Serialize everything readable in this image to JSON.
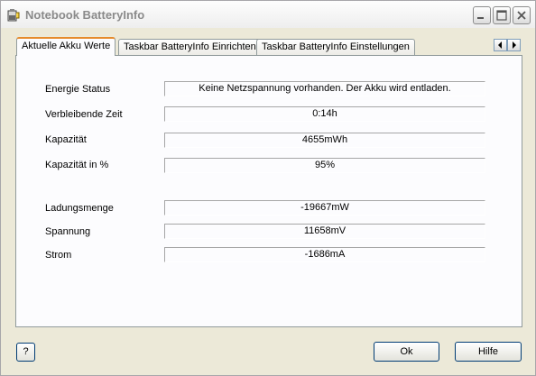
{
  "window": {
    "title": "Notebook BatteryInfo"
  },
  "tabs": [
    {
      "label": "Aktuelle Akku Werte"
    },
    {
      "label": "Taskbar BatteryInfo Einrichten"
    },
    {
      "label": "Taskbar BatteryInfo Einstellungen"
    }
  ],
  "fields": [
    {
      "label": "Energie Status",
      "value": "Keine Netzspannung vorhanden. Der Akku wird entladen."
    },
    {
      "label": "Verbleibende Zeit",
      "value": "0:14h"
    },
    {
      "label": "Kapazität",
      "value": "4655mWh"
    },
    {
      "label": "Kapazität in %",
      "value": "95%"
    },
    {
      "label": "Ladungsmenge",
      "value": "-19667mW"
    },
    {
      "label": "Spannung",
      "value": "11658mV"
    },
    {
      "label": "Strom",
      "value": "-1686mA"
    }
  ],
  "buttons": {
    "help_q": "?",
    "ok": "Ok",
    "hilfe": "Hilfe"
  }
}
